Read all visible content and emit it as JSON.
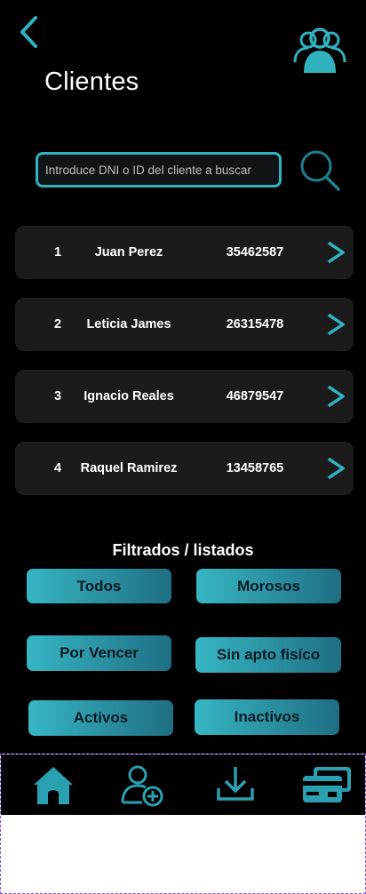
{
  "header": {
    "title": "Clientes",
    "back_icon": "chevron-left-icon",
    "avatar_icon": "users-group-icon"
  },
  "search": {
    "placeholder": "Introduce DNI o ID del cliente a buscar",
    "button_icon": "search-icon"
  },
  "clients": [
    {
      "number": "1",
      "name": "Juan Perez",
      "dni": "35462587"
    },
    {
      "number": "2",
      "name": "Leticia James",
      "dni": "26315478"
    },
    {
      "number": "3",
      "name": "Ignacio Reales",
      "dni": "46879547"
    },
    {
      "number": "4",
      "name": "Raquel Ramirez",
      "dni": "13458765"
    }
  ],
  "filters": {
    "title": "Filtrados / listados",
    "buttons": [
      "Todos",
      "Morosos",
      "Por Vencer",
      "Sin apto fisíco",
      "Activos",
      "Inactivos"
    ]
  },
  "bottom_nav": {
    "icons": [
      "home-icon",
      "add-user-icon",
      "download-icon",
      "payment-card-icon"
    ]
  },
  "colors": {
    "background": "#000000",
    "accent": "#31b2bf",
    "row_background": "#1b1b1b",
    "gradient_start": "#37b6c3",
    "gradient_end": "#1f6e83"
  }
}
